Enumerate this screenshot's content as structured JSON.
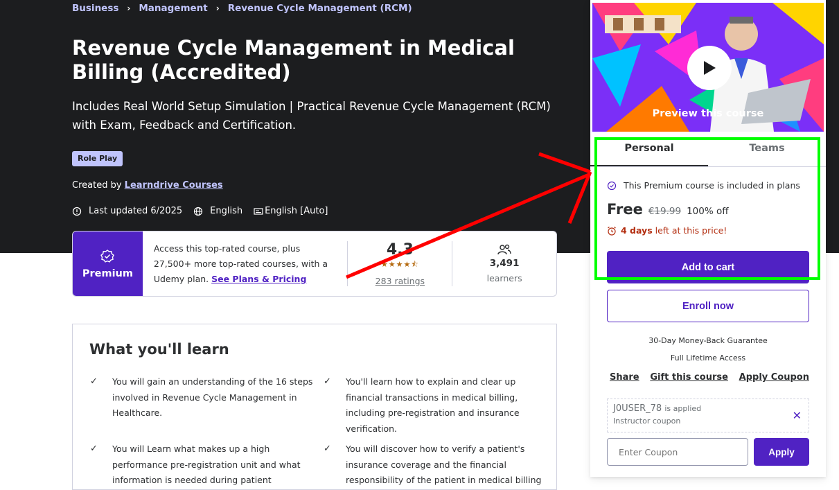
{
  "breadcrumb": [
    "Business",
    "Management",
    "Revenue Cycle Management (RCM)"
  ],
  "course": {
    "title": "Revenue Cycle Management in Medical Billing (Accredited)",
    "subtitle": "Includes Real World Setup Simulation | Practical Revenue Cycle Management (RCM) with Exam, Feedback and Certification.",
    "badge": "Role Play",
    "created_by_label": "Created by",
    "author": "Learndrive Courses",
    "last_updated": "Last updated 6/2025",
    "language": "English",
    "captions": "English [Auto]"
  },
  "premium": {
    "label": "Premium",
    "text": "Access this top-rated course, plus 27,500+ more top-rated courses, with a Udemy plan. ",
    "link": "See Plans & Pricing",
    "rating": "4.3",
    "stars": "★★★★⯪",
    "ratings_count": "283 ratings",
    "learners_count": "3,491",
    "learners_label": "learners"
  },
  "learn": {
    "title": "What you'll learn",
    "items": [
      "You will gain an understanding of the 16 steps involved in Revenue Cycle Management in Healthcare.",
      "You'll learn how to explain and clear up financial transactions in medical billing, including pre-registration and insurance verification.",
      "You will Learn what makes up a high performance pre-registration unit and what information is needed during patient",
      "You will discover how to verify a patient's insurance coverage and the financial responsibility of the patient in medical billing"
    ]
  },
  "sidebar": {
    "preview_label": "Preview this course",
    "tabs": [
      "Personal",
      "Teams"
    ],
    "plan_note": "This Premium course is included in plans",
    "price": "Free",
    "old_price": "€19.99",
    "discount": "100% off",
    "timer_days": "4 days",
    "timer_rest": " left at this price!",
    "add_to_cart": "Add to cart",
    "enroll": "Enroll now",
    "guarantee": "30-Day Money-Back Guarantee",
    "access": "Full Lifetime Access",
    "links": [
      "Share",
      "Gift this course",
      "Apply Coupon"
    ],
    "coupon_code": "J0USER_78",
    "coupon_applied": "is applied",
    "coupon_sub": "Instructor coupon",
    "coupon_placeholder": "Enter Coupon",
    "apply": "Apply"
  },
  "colors": {
    "hero_bg": "#1c1d1f",
    "brand_purple": "#5022c3",
    "link_lavender": "#c0c4fc",
    "annotation_red": "#ff0000",
    "annotation_green": "#00ff00"
  }
}
